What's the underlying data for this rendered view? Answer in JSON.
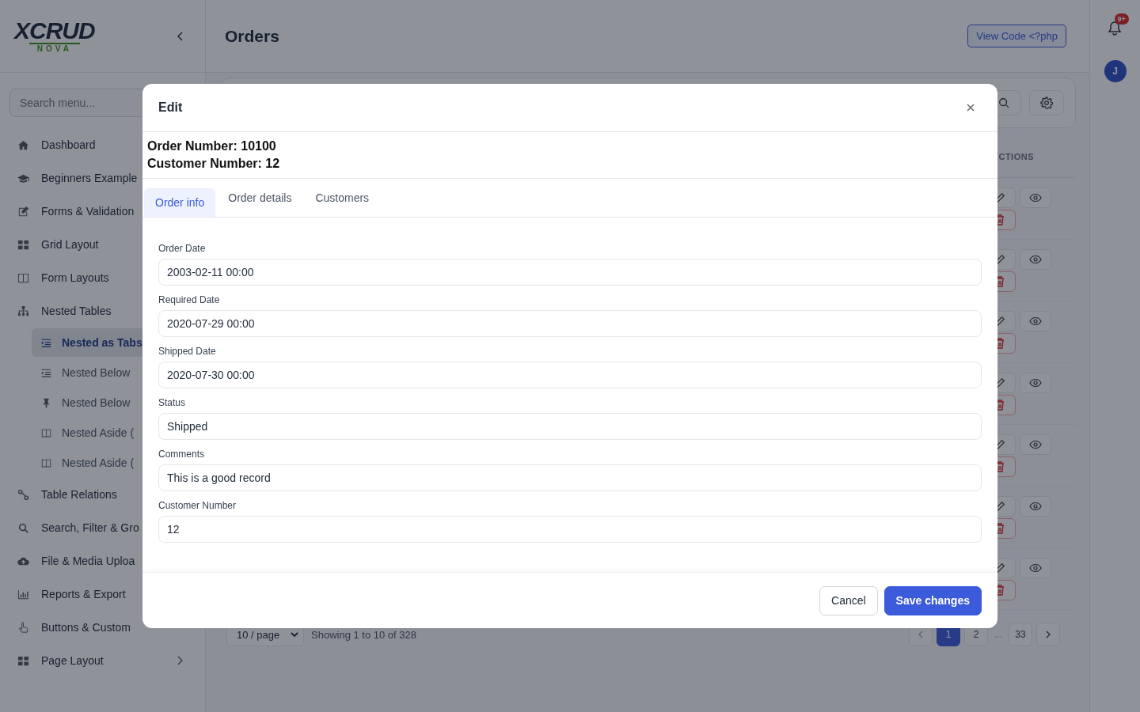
{
  "sidebar": {
    "brand": {
      "name": "XCRUD",
      "tagline": "NOVA"
    },
    "search": {
      "placeholder": "Search menu..."
    },
    "items": [
      {
        "label": "Dashboard",
        "selected": false
      },
      {
        "label": "Beginners Example",
        "selected": false
      },
      {
        "label": "Forms & Validation",
        "selected": false
      },
      {
        "label": "Grid Layout",
        "selected": false
      },
      {
        "label": "Form Layouts",
        "selected": false
      },
      {
        "label": "Nested Tables",
        "selected": false,
        "expanded": true,
        "children": [
          {
            "label": "Nested as Tabs",
            "selected": true
          },
          {
            "label": "Nested Below",
            "selected": false
          },
          {
            "label": "Nested Below",
            "selected": false
          },
          {
            "label": "Nested Aside (",
            "selected": false
          },
          {
            "label": "Nested Aside (",
            "selected": false
          }
        ]
      },
      {
        "label": "Table Relations",
        "selected": false
      },
      {
        "label": "Search, Filter & Gro",
        "selected": false
      },
      {
        "label": "File & Media Uploa",
        "selected": false
      },
      {
        "label": "Reports & Export",
        "selected": false
      },
      {
        "label": "Buttons & Custom",
        "selected": false
      },
      {
        "label": "Page Layout",
        "selected": false,
        "expanded": false
      }
    ]
  },
  "header": {
    "title": "Orders",
    "button": "View Code <?php"
  },
  "rail": {
    "badge": "9+",
    "avatar": "J"
  },
  "table": {
    "actions_header": "CTIONS"
  },
  "footer": {
    "page_size": "10 / page",
    "summary": "Showing 1 to 10 of 328",
    "pages": [
      {
        "label": "1",
        "selected": true
      },
      {
        "label": "2",
        "selected": false
      },
      {
        "label": "...",
        "kind": "gap"
      },
      {
        "label": "33",
        "selected": false
      }
    ]
  },
  "modal": {
    "title": "Edit",
    "info": [
      "Order Number: 10100",
      "Customer Number: 12"
    ],
    "tabs": [
      {
        "label": "Order info",
        "selected": true
      },
      {
        "label": "Order details",
        "selected": false
      },
      {
        "label": "Customers",
        "selected": false
      }
    ],
    "fields": [
      {
        "label": "Order Date",
        "value": "2003-02-11 00:00"
      },
      {
        "label": "Required Date",
        "value": "2020-07-29 00:00"
      },
      {
        "label": "Shipped Date",
        "value": "2020-07-30 00:00"
      },
      {
        "label": "Status",
        "value": "Shipped"
      },
      {
        "label": "Comments",
        "value": "This is a good record"
      },
      {
        "label": "Customer Number",
        "value": "12"
      }
    ],
    "buttons": [
      {
        "label": "Cancel",
        "kind": "secondary"
      },
      {
        "label": "Save changes",
        "kind": "primary"
      }
    ]
  }
}
